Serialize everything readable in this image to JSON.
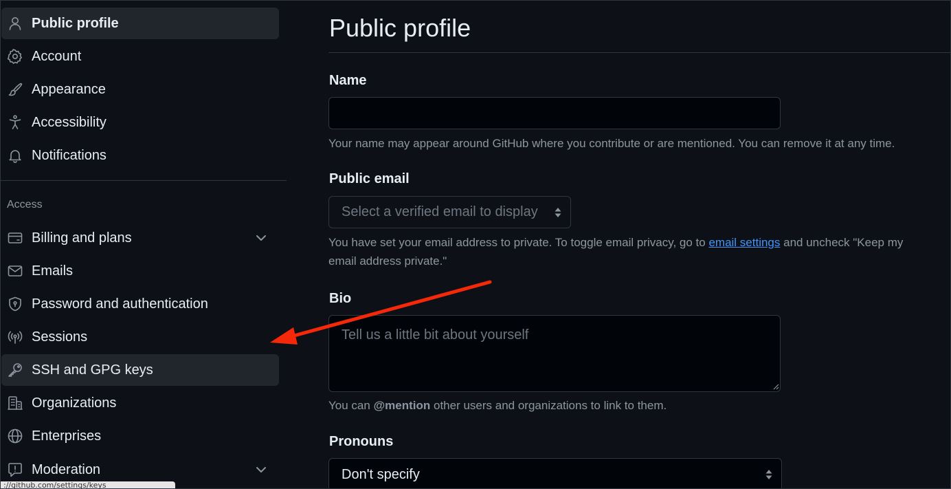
{
  "sidebar": {
    "items_top": [
      {
        "label": "Public profile",
        "icon": "person-icon"
      },
      {
        "label": "Account",
        "icon": "gear-icon"
      },
      {
        "label": "Appearance",
        "icon": "paintbrush-icon"
      },
      {
        "label": "Accessibility",
        "icon": "accessibility-icon"
      },
      {
        "label": "Notifications",
        "icon": "bell-icon"
      }
    ],
    "access_heading": "Access",
    "items_access": [
      {
        "label": "Billing and plans",
        "icon": "credit-card-icon"
      },
      {
        "label": "Emails",
        "icon": "mail-icon"
      },
      {
        "label": "Password and authentication",
        "icon": "shield-lock-icon"
      },
      {
        "label": "Sessions",
        "icon": "broadcast-icon"
      },
      {
        "label": "SSH and GPG keys",
        "icon": "key-icon"
      },
      {
        "label": "Organizations",
        "icon": "organization-icon"
      },
      {
        "label": "Enterprises",
        "icon": "globe-icon"
      },
      {
        "label": "Moderation",
        "icon": "report-icon"
      }
    ],
    "status_url": "://github.com/settings/keys"
  },
  "main": {
    "title": "Public profile",
    "name": {
      "label": "Name",
      "value": "",
      "note": "Your name may appear around GitHub where you contribute or are mentioned. You can remove it at any time."
    },
    "public_email": {
      "label": "Public email",
      "placeholder": "Select a verified email to display",
      "note_before": "You have set your email address to private. To toggle email privacy, go to",
      "note_link": "email settings",
      "note_after": "and uncheck \"Keep my email address private.\""
    },
    "bio": {
      "label": "Bio",
      "placeholder": "Tell us a little bit about yourself",
      "note_before": "You can",
      "note_mention": "@mention",
      "note_after": "other users and organizations to link to them."
    },
    "pronouns": {
      "label": "Pronouns",
      "selected": "Don't specify"
    }
  },
  "colors": {
    "background": "#0d1117",
    "selected_item_bg": "#21262d",
    "link": "#4493f8",
    "annotation_arrow": "#f5290a"
  }
}
